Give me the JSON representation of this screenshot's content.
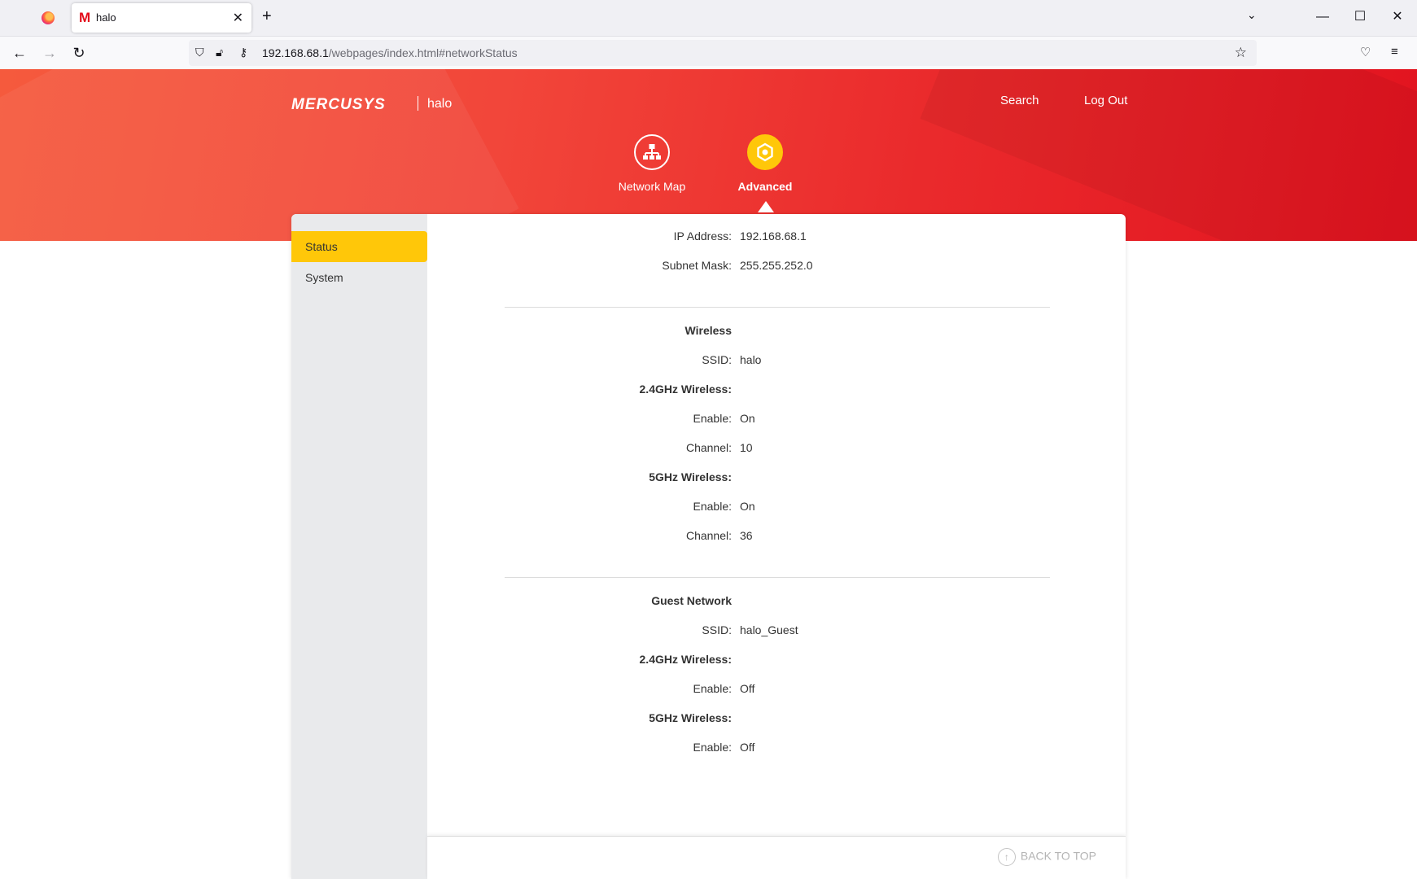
{
  "browser": {
    "tab_title": "halo",
    "tab_favicon": "M",
    "url_host": "192.168.68.1",
    "url_path": "/webpages/index.html#networkStatus"
  },
  "header": {
    "brand": "MERCUSYS",
    "device_name": "halo",
    "search_label": "Search",
    "logout_label": "Log Out",
    "modes": [
      {
        "label": "Network Map",
        "icon": "network-map-icon",
        "active": false
      },
      {
        "label": "Advanced",
        "icon": "gear-icon",
        "active": true
      }
    ]
  },
  "sidebar": {
    "items": [
      {
        "label": "Status",
        "active": true
      },
      {
        "label": "System",
        "active": false
      }
    ]
  },
  "lan": {
    "ip_label": "IP Address:",
    "ip_value": "192.168.68.1",
    "mask_label": "Subnet Mask:",
    "mask_value": "255.255.252.0"
  },
  "wireless": {
    "title": "Wireless",
    "ssid_label": "SSID:",
    "ssid_value": "halo",
    "band24_title": "2.4GHz Wireless:",
    "band24_enable_label": "Enable:",
    "band24_enable_value": "On",
    "band24_channel_label": "Channel:",
    "band24_channel_value": "10",
    "band5_title": "5GHz Wireless:",
    "band5_enable_label": "Enable:",
    "band5_enable_value": "On",
    "band5_channel_label": "Channel:",
    "band5_channel_value": "36"
  },
  "guest": {
    "title": "Guest Network",
    "ssid_label": "SSID:",
    "ssid_value": "halo_Guest",
    "band24_title": "2.4GHz Wireless:",
    "band24_enable_label": "Enable:",
    "band24_enable_value": "Off",
    "band5_title": "5GHz Wireless:",
    "band5_enable_label": "Enable:",
    "band5_enable_value": "Off"
  },
  "footer": {
    "back_to_top": "BACK TO TOP"
  },
  "colors": {
    "accent": "#ffc709",
    "brand_red": "#e2131f"
  }
}
